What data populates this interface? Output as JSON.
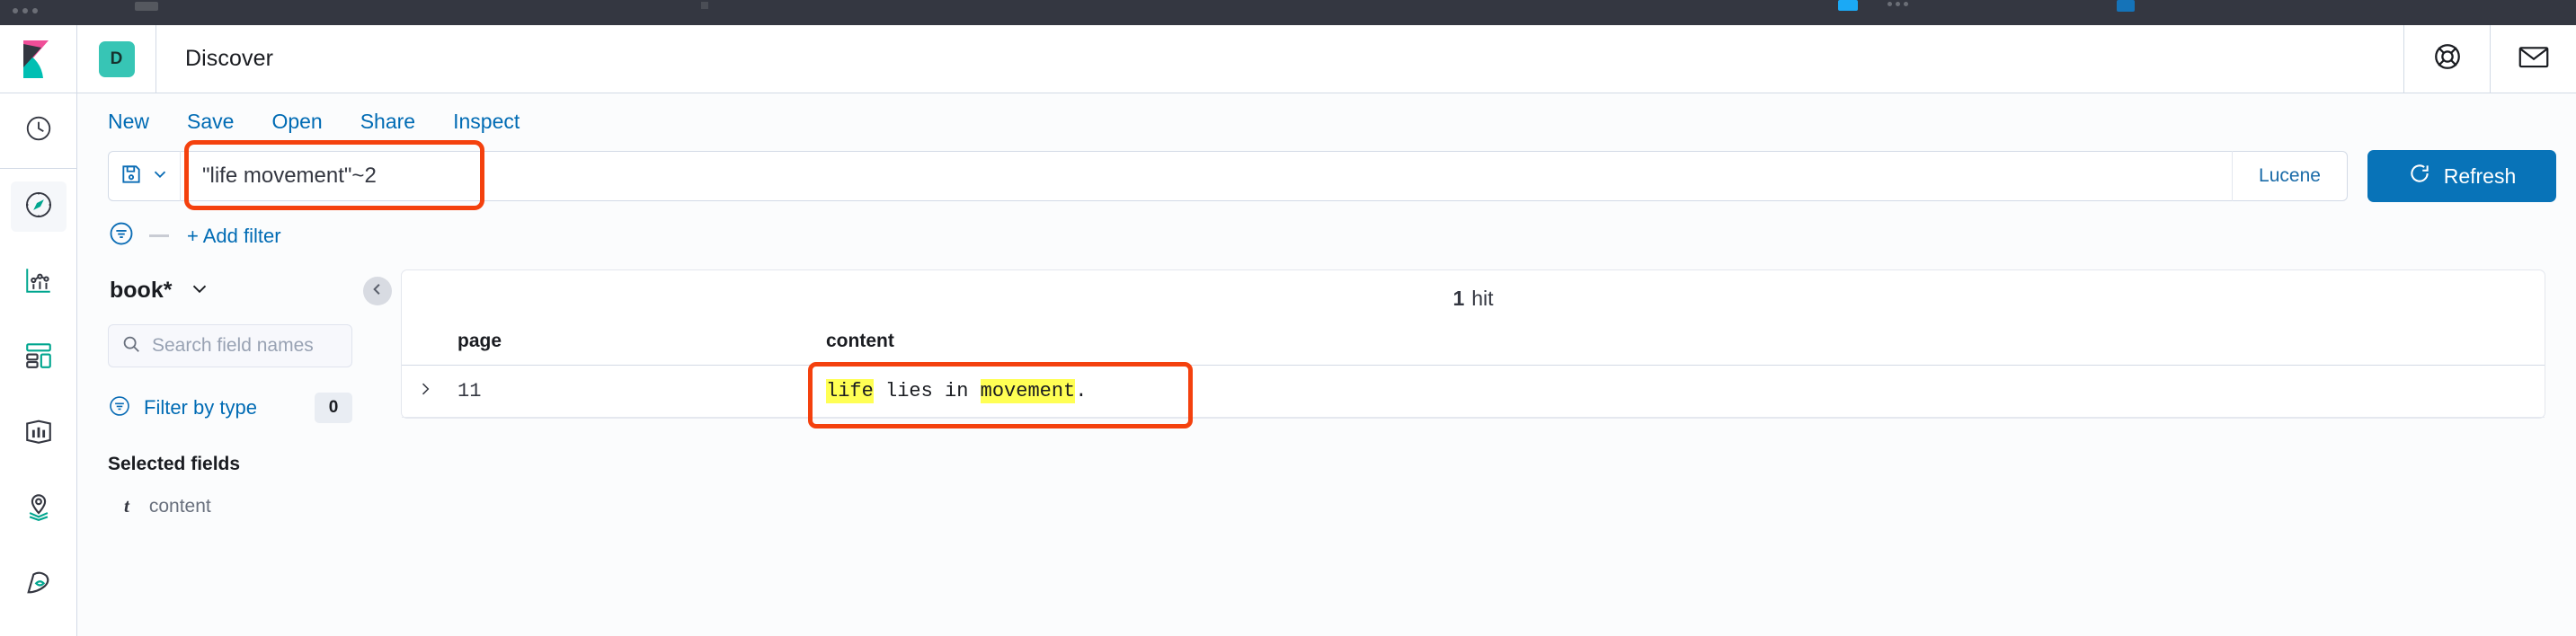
{
  "browser": {
    "chrome_visible": true
  },
  "header": {
    "space_badge": "D",
    "app_title": "Discover",
    "help_icon": "life-ring-icon",
    "mail_icon": "envelope-icon"
  },
  "global_nav": {
    "items": [
      {
        "icon": "clock-icon",
        "name": "recently-viewed"
      },
      {
        "icon": "compass-icon",
        "name": "discover",
        "active": true
      },
      {
        "icon": "chart-icon",
        "name": "visualize"
      },
      {
        "icon": "dashboard-icon",
        "name": "dashboard"
      },
      {
        "icon": "canvas-icon",
        "name": "canvas"
      },
      {
        "icon": "maps-icon",
        "name": "maps"
      },
      {
        "icon": "ml-icon",
        "name": "machine-learning"
      }
    ]
  },
  "top_menu": {
    "items": [
      {
        "label": "New"
      },
      {
        "label": "Save"
      },
      {
        "label": "Open"
      },
      {
        "label": "Share"
      },
      {
        "label": "Inspect"
      }
    ]
  },
  "query_bar": {
    "saved_query_icon": "save-disk-icon",
    "chevron_icon": "chevron-down-icon",
    "query_value": "\"life movement\"~2",
    "query_placeholder": "Search",
    "language_label": "Lucene",
    "refresh_label": "Refresh",
    "refresh_icon": "refresh-icon",
    "highlight_color": "#f4410e"
  },
  "filter_bar": {
    "filter_icon": "filter-funnel-icon",
    "add_filter_label": "+ Add filter"
  },
  "sidebar": {
    "index_pattern": "book*",
    "index_pattern_chevron": "chevron-down-icon",
    "search_placeholder": "Search field names",
    "search_value": "",
    "search_icon": "search-icon",
    "filter_by_type_label": "Filter by type",
    "filter_by_type_icon": "filter-funnel-icon",
    "filter_by_type_count": "0",
    "selected_fields_title": "Selected fields",
    "selected_fields": [
      {
        "type_icon": "t",
        "name": "content"
      }
    ]
  },
  "results": {
    "collapse_icon": "chevron-left-icon",
    "hit_count": "1",
    "hit_label": "hit",
    "columns": [
      "page",
      "content"
    ],
    "rows": [
      {
        "expand_icon": "chevron-right-icon",
        "page": "11",
        "content_parts": [
          {
            "text": "life",
            "highlight": true
          },
          {
            "text": " lies in ",
            "highlight": false
          },
          {
            "text": "movement",
            "highlight": true
          },
          {
            "text": ".",
            "highlight": false
          }
        ]
      }
    ],
    "highlight_color": "#f4410e",
    "match_highlight_color": "#ffff54"
  }
}
